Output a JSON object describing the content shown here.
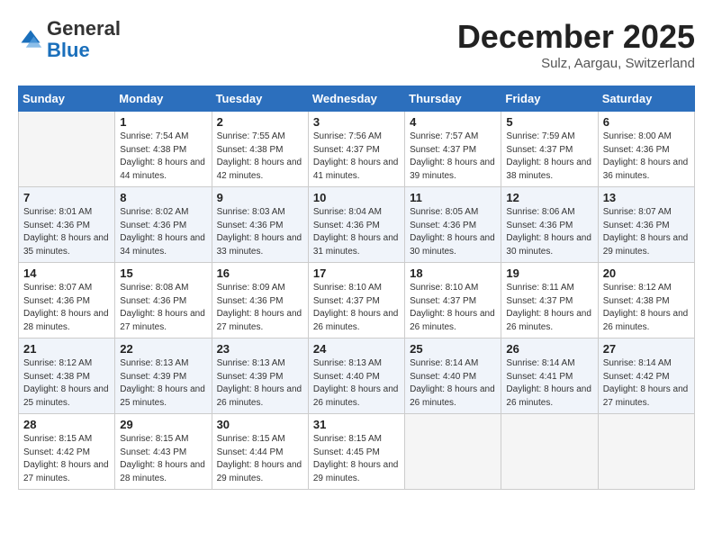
{
  "header": {
    "logo_general": "General",
    "logo_blue": "Blue",
    "month_title": "December 2025",
    "location": "Sulz, Aargau, Switzerland"
  },
  "weekdays": [
    "Sunday",
    "Monday",
    "Tuesday",
    "Wednesday",
    "Thursday",
    "Friday",
    "Saturday"
  ],
  "weeks": [
    [
      {
        "day": "",
        "sunrise": "",
        "sunset": "",
        "daylight": "",
        "empty": true
      },
      {
        "day": "1",
        "sunrise": "Sunrise: 7:54 AM",
        "sunset": "Sunset: 4:38 PM",
        "daylight": "Daylight: 8 hours and 44 minutes."
      },
      {
        "day": "2",
        "sunrise": "Sunrise: 7:55 AM",
        "sunset": "Sunset: 4:38 PM",
        "daylight": "Daylight: 8 hours and 42 minutes."
      },
      {
        "day": "3",
        "sunrise": "Sunrise: 7:56 AM",
        "sunset": "Sunset: 4:37 PM",
        "daylight": "Daylight: 8 hours and 41 minutes."
      },
      {
        "day": "4",
        "sunrise": "Sunrise: 7:57 AM",
        "sunset": "Sunset: 4:37 PM",
        "daylight": "Daylight: 8 hours and 39 minutes."
      },
      {
        "day": "5",
        "sunrise": "Sunrise: 7:59 AM",
        "sunset": "Sunset: 4:37 PM",
        "daylight": "Daylight: 8 hours and 38 minutes."
      },
      {
        "day": "6",
        "sunrise": "Sunrise: 8:00 AM",
        "sunset": "Sunset: 4:36 PM",
        "daylight": "Daylight: 8 hours and 36 minutes."
      }
    ],
    [
      {
        "day": "7",
        "sunrise": "Sunrise: 8:01 AM",
        "sunset": "Sunset: 4:36 PM",
        "daylight": "Daylight: 8 hours and 35 minutes."
      },
      {
        "day": "8",
        "sunrise": "Sunrise: 8:02 AM",
        "sunset": "Sunset: 4:36 PM",
        "daylight": "Daylight: 8 hours and 34 minutes."
      },
      {
        "day": "9",
        "sunrise": "Sunrise: 8:03 AM",
        "sunset": "Sunset: 4:36 PM",
        "daylight": "Daylight: 8 hours and 33 minutes."
      },
      {
        "day": "10",
        "sunrise": "Sunrise: 8:04 AM",
        "sunset": "Sunset: 4:36 PM",
        "daylight": "Daylight: 8 hours and 31 minutes."
      },
      {
        "day": "11",
        "sunrise": "Sunrise: 8:05 AM",
        "sunset": "Sunset: 4:36 PM",
        "daylight": "Daylight: 8 hours and 30 minutes."
      },
      {
        "day": "12",
        "sunrise": "Sunrise: 8:06 AM",
        "sunset": "Sunset: 4:36 PM",
        "daylight": "Daylight: 8 hours and 30 minutes."
      },
      {
        "day": "13",
        "sunrise": "Sunrise: 8:07 AM",
        "sunset": "Sunset: 4:36 PM",
        "daylight": "Daylight: 8 hours and 29 minutes."
      }
    ],
    [
      {
        "day": "14",
        "sunrise": "Sunrise: 8:07 AM",
        "sunset": "Sunset: 4:36 PM",
        "daylight": "Daylight: 8 hours and 28 minutes."
      },
      {
        "day": "15",
        "sunrise": "Sunrise: 8:08 AM",
        "sunset": "Sunset: 4:36 PM",
        "daylight": "Daylight: 8 hours and 27 minutes."
      },
      {
        "day": "16",
        "sunrise": "Sunrise: 8:09 AM",
        "sunset": "Sunset: 4:36 PM",
        "daylight": "Daylight: 8 hours and 27 minutes."
      },
      {
        "day": "17",
        "sunrise": "Sunrise: 8:10 AM",
        "sunset": "Sunset: 4:37 PM",
        "daylight": "Daylight: 8 hours and 26 minutes."
      },
      {
        "day": "18",
        "sunrise": "Sunrise: 8:10 AM",
        "sunset": "Sunset: 4:37 PM",
        "daylight": "Daylight: 8 hours and 26 minutes."
      },
      {
        "day": "19",
        "sunrise": "Sunrise: 8:11 AM",
        "sunset": "Sunset: 4:37 PM",
        "daylight": "Daylight: 8 hours and 26 minutes."
      },
      {
        "day": "20",
        "sunrise": "Sunrise: 8:12 AM",
        "sunset": "Sunset: 4:38 PM",
        "daylight": "Daylight: 8 hours and 26 minutes."
      }
    ],
    [
      {
        "day": "21",
        "sunrise": "Sunrise: 8:12 AM",
        "sunset": "Sunset: 4:38 PM",
        "daylight": "Daylight: 8 hours and 25 minutes."
      },
      {
        "day": "22",
        "sunrise": "Sunrise: 8:13 AM",
        "sunset": "Sunset: 4:39 PM",
        "daylight": "Daylight: 8 hours and 25 minutes."
      },
      {
        "day": "23",
        "sunrise": "Sunrise: 8:13 AM",
        "sunset": "Sunset: 4:39 PM",
        "daylight": "Daylight: 8 hours and 26 minutes."
      },
      {
        "day": "24",
        "sunrise": "Sunrise: 8:13 AM",
        "sunset": "Sunset: 4:40 PM",
        "daylight": "Daylight: 8 hours and 26 minutes."
      },
      {
        "day": "25",
        "sunrise": "Sunrise: 8:14 AM",
        "sunset": "Sunset: 4:40 PM",
        "daylight": "Daylight: 8 hours and 26 minutes."
      },
      {
        "day": "26",
        "sunrise": "Sunrise: 8:14 AM",
        "sunset": "Sunset: 4:41 PM",
        "daylight": "Daylight: 8 hours and 26 minutes."
      },
      {
        "day": "27",
        "sunrise": "Sunrise: 8:14 AM",
        "sunset": "Sunset: 4:42 PM",
        "daylight": "Daylight: 8 hours and 27 minutes."
      }
    ],
    [
      {
        "day": "28",
        "sunrise": "Sunrise: 8:15 AM",
        "sunset": "Sunset: 4:42 PM",
        "daylight": "Daylight: 8 hours and 27 minutes."
      },
      {
        "day": "29",
        "sunrise": "Sunrise: 8:15 AM",
        "sunset": "Sunset: 4:43 PM",
        "daylight": "Daylight: 8 hours and 28 minutes."
      },
      {
        "day": "30",
        "sunrise": "Sunrise: 8:15 AM",
        "sunset": "Sunset: 4:44 PM",
        "daylight": "Daylight: 8 hours and 29 minutes."
      },
      {
        "day": "31",
        "sunrise": "Sunrise: 8:15 AM",
        "sunset": "Sunset: 4:45 PM",
        "daylight": "Daylight: 8 hours and 29 minutes."
      },
      {
        "day": "",
        "sunrise": "",
        "sunset": "",
        "daylight": "",
        "empty": true
      },
      {
        "day": "",
        "sunrise": "",
        "sunset": "",
        "daylight": "",
        "empty": true
      },
      {
        "day": "",
        "sunrise": "",
        "sunset": "",
        "daylight": "",
        "empty": true
      }
    ]
  ]
}
